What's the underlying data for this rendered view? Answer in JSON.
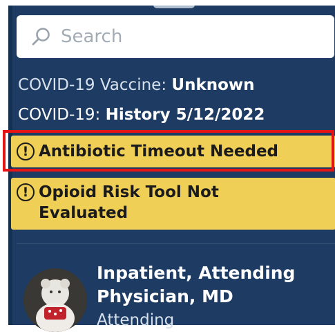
{
  "search": {
    "placeholder": "Search"
  },
  "status": {
    "vaccine_label": "COVID-19 Vaccine:",
    "vaccine_value": "Unknown",
    "covid_label": "COVID-19:",
    "covid_value": "History 5/12/2022"
  },
  "alerts": [
    {
      "text": "Antibiotic Timeout Needed",
      "highlighted": true
    },
    {
      "text": "Opioid Risk Tool Not Evaluated",
      "highlighted": false
    }
  ],
  "user": {
    "name": "Inpatient, Attending Physician, MD",
    "role": "Attending"
  },
  "colors": {
    "panel": "#1e3c63",
    "alert": "#f0cf56",
    "highlight": "#e61515"
  },
  "icons": {
    "search": "search-icon",
    "alert": "exclamation-circle-icon"
  }
}
